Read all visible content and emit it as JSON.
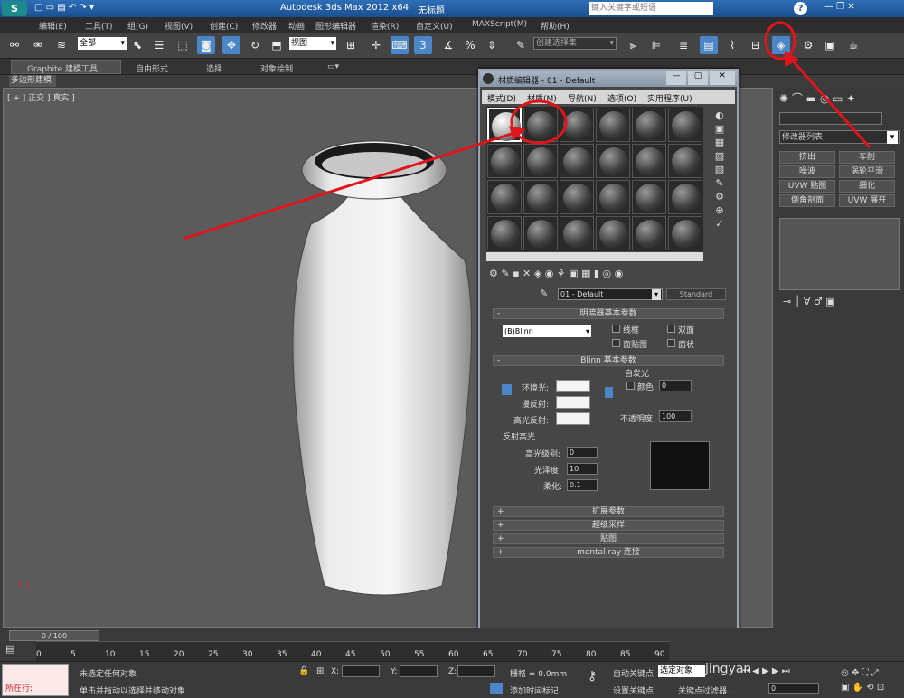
{
  "title": {
    "app": "Autodesk 3ds Max  2012 x64",
    "doc": "无标题",
    "search_placeholder": "键入关键字或短语"
  },
  "menu": [
    "编辑(E)",
    "工具(T)",
    "组(G)",
    "视图(V)",
    "创建(C)",
    "修改器",
    "动画",
    "图形编辑器",
    "渲染(R)",
    "自定义(U)",
    "MAXScript(M)",
    "帮助(H)"
  ],
  "toolbar": {
    "filter": "全部",
    "refcoord": "视图",
    "selset": "创建选择集"
  },
  "ribbon": {
    "tabs": [
      "Graphite 建模工具",
      "自由形式",
      "选择",
      "对象绘制"
    ],
    "sub": "多边形建模"
  },
  "viewport": {
    "label": "[ + ] 正交 ] 真实 ]"
  },
  "med": {
    "title": "材质编辑器 - 01 - Default",
    "menu": [
      "模式(D)",
      "材质(M)",
      "导航(N)",
      "选项(O)",
      "实用程序(U)"
    ],
    "mat_name": "01 - Default",
    "mat_type": "Standard",
    "shader_head": "明暗器基本参数",
    "shader": "(B)Blinn",
    "opts": [
      "线框",
      "双面",
      "面贴图",
      "面状"
    ],
    "blinn_head": "Blinn 基本参数",
    "self_illum": "自发光",
    "color": "颜色",
    "color_val": "0",
    "ambient": "环境光:",
    "diffuse": "漫反射:",
    "specular": "高光反射:",
    "opacity": "不透明度:",
    "opacity_val": "100",
    "refl_head": "反射高光",
    "spec_level": "高光级别:",
    "spec_level_val": "0",
    "gloss": "光泽度:",
    "gloss_val": "10",
    "soften": "柔化:",
    "soften_val": "0.1",
    "rollouts": [
      "扩展参数",
      "超级采样",
      "贴图",
      "mental ray 连接"
    ]
  },
  "rpanel": {
    "list": "修改器列表",
    "btns": [
      "挤出",
      "车削",
      "噪波",
      "涡轮平滑",
      "UVW 贴图",
      "细化",
      "倒角剖面",
      "UVW 展开"
    ]
  },
  "timeline": {
    "frame": "0 / 100",
    "ticks": [
      "0",
      "5",
      "10",
      "15",
      "20",
      "25",
      "30",
      "35",
      "40",
      "45",
      "50",
      "55",
      "60",
      "65",
      "70",
      "75",
      "80",
      "85",
      "90"
    ]
  },
  "status": {
    "sel": "未选定任何对象",
    "hint": "单击并拖动以选择并移动对象",
    "x": "X:",
    "y": "Y:",
    "z": "Z:",
    "grid": "栅格 = 0.0mm",
    "add_time": "添加时间标记",
    "autokey": "自动关键点",
    "setkey": "设置关键点",
    "selobj": "选定对象",
    "keyfilter": "关键点过滤器...",
    "frame": "0",
    "running": "所在行:",
    "watermark": "jingyan"
  },
  "colors": {
    "arrow": "#e0141b"
  }
}
